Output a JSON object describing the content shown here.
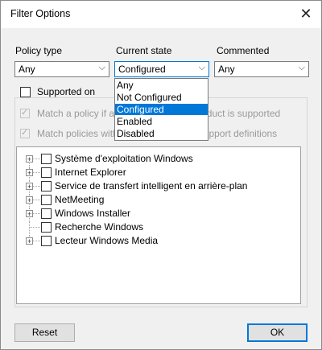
{
  "window": {
    "title": "Filter Options"
  },
  "filters": {
    "policy_type": {
      "label": "Policy type",
      "value": "Any"
    },
    "current_state": {
      "label": "Current state",
      "value": "Configured"
    },
    "commented": {
      "label": "Commented",
      "value": "Any"
    }
  },
  "dropdown": {
    "options": [
      "Any",
      "Not Configured",
      "Configured",
      "Enabled",
      "Disabled"
    ],
    "selected": "Configured"
  },
  "supported": {
    "label": "Supported on",
    "match_policy_label": "Match a policy if any of the selected product is supported",
    "match_all_label": "Match policies with all of the selected support definitions"
  },
  "tree": {
    "items": [
      {
        "label": "Système d'exploitation Windows",
        "expandable": true
      },
      {
        "label": "Internet Explorer",
        "expandable": true
      },
      {
        "label": "Service de transfert intelligent en arrière-plan",
        "expandable": true
      },
      {
        "label": "NetMeeting",
        "expandable": true
      },
      {
        "label": "Windows Installer",
        "expandable": true
      },
      {
        "label": "Recherche Windows",
        "expandable": false
      },
      {
        "label": "Lecteur Windows Media",
        "expandable": true
      }
    ]
  },
  "buttons": {
    "reset": "Reset",
    "ok": "OK"
  }
}
